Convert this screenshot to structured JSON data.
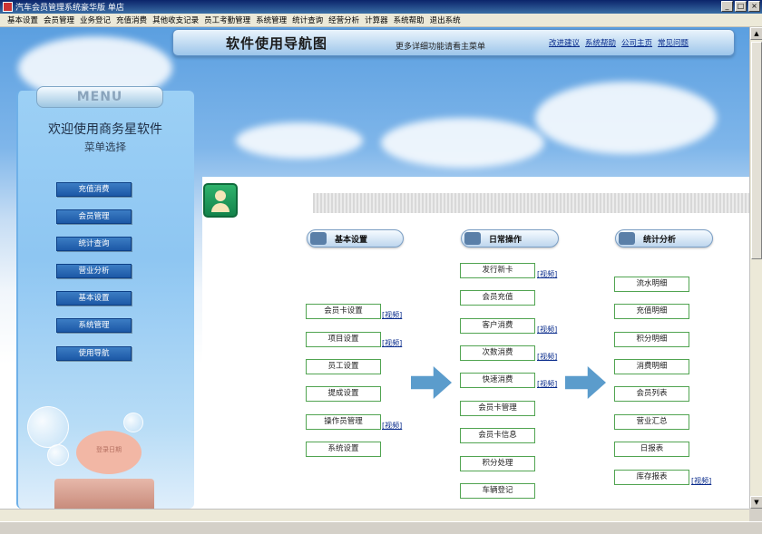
{
  "window": {
    "title": "汽车会员管理系统豪华版 单店",
    "controls": [
      "_",
      "□",
      "×"
    ]
  },
  "menubar": [
    "基本设置",
    "会员管理",
    "业务登记",
    "充值消费",
    "其他收支记录",
    "员工考勤管理",
    "系统管理",
    "统计查询",
    "经营分析",
    "计算器",
    "系统帮助",
    "退出系统"
  ],
  "header": {
    "title": "软件使用导航图",
    "subtitle": "更多详细功能请看主菜单",
    "links": [
      "改进建议",
      "系统帮助",
      "公司主页",
      "常见问题"
    ]
  },
  "left_menu": {
    "tab": "MENU",
    "welcome": "欢迎使用商务星软件",
    "subtitle": "菜单选择",
    "items": [
      "充值消费",
      "会员管理",
      "统计查询",
      "营业分析",
      "基本设置",
      "系统管理",
      "使用导航"
    ],
    "sign_text": "登录日期"
  },
  "sections": {
    "basic": {
      "title": "基本设置",
      "items": [
        "会员卡设置",
        "项目设置",
        "员工设置",
        "提成设置",
        "操作员管理",
        "系统设置"
      ],
      "video_labels": [
        "[视频]",
        "[视频]",
        "[视频]"
      ]
    },
    "daily": {
      "title": "日常操作",
      "items": [
        "发行新卡",
        "会员充值",
        "客户消费",
        "次数消费",
        "快速消费",
        "会员卡管理",
        "会员卡信息",
        "积分处理",
        "车辆登记"
      ],
      "video_labels": [
        "[视频]",
        "[视频]",
        "[视频]",
        "[视频]"
      ]
    },
    "stats": {
      "title": "统计分析",
      "items": [
        "流水明细",
        "充值明细",
        "积分明细",
        "消费明细",
        "会员列表",
        "营业汇总",
        "日报表",
        "库存报表"
      ],
      "video_labels": [
        "[视频]"
      ]
    }
  },
  "colors": {
    "accent_blue": "#1c58a6",
    "button_border_green": "#51a451",
    "arrow": "#5b9ccc",
    "link": "#0a2c8c"
  }
}
